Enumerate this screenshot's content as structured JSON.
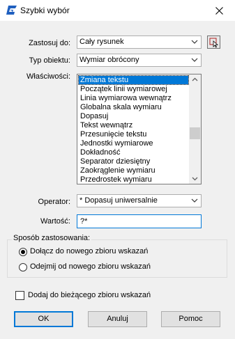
{
  "window": {
    "title": "Szybki wybór"
  },
  "form": {
    "apply_to": {
      "label": "Zastosuj do:",
      "value": "Cały rysunek"
    },
    "object_type": {
      "label": "Typ obiektu:",
      "value": "Wymiar obrócony"
    },
    "properties": {
      "label": "Właściwości:",
      "items": [
        "Zmiana tekstu",
        "Początek linii wymiarowej",
        "Linia wymiarowa wewnątrz",
        "Globalna skala wymiaru",
        "Dopasuj",
        "Tekst wewnątrz",
        "Przesunięcie tekstu",
        "Jednostki wymiarowe",
        "Dokładność",
        "Separator dziesiętny",
        "Zaokrąglenie wymiaru",
        "Przedrostek wymiaru"
      ],
      "selected_index": 0
    },
    "operator": {
      "label": "Operator:",
      "value": "* Dopasuj uniwersalnie"
    },
    "value": {
      "label": "Wartość:",
      "value": "?*"
    }
  },
  "apply_mode": {
    "title": "Sposób zastosowania:",
    "options": [
      {
        "label": "Dołącz do nowego zbioru wskazań",
        "selected": true
      },
      {
        "label": "Odejmij od nowego zbioru wskazań",
        "selected": false
      }
    ]
  },
  "append": {
    "label": "Dodaj do bieżącego zbioru wskazań",
    "checked": false
  },
  "buttons": {
    "ok": "OK",
    "cancel": "Anuluj",
    "help": "Pomoc"
  },
  "colors": {
    "accent": "#0078d7",
    "icon_blue": "#1f5fbf"
  }
}
